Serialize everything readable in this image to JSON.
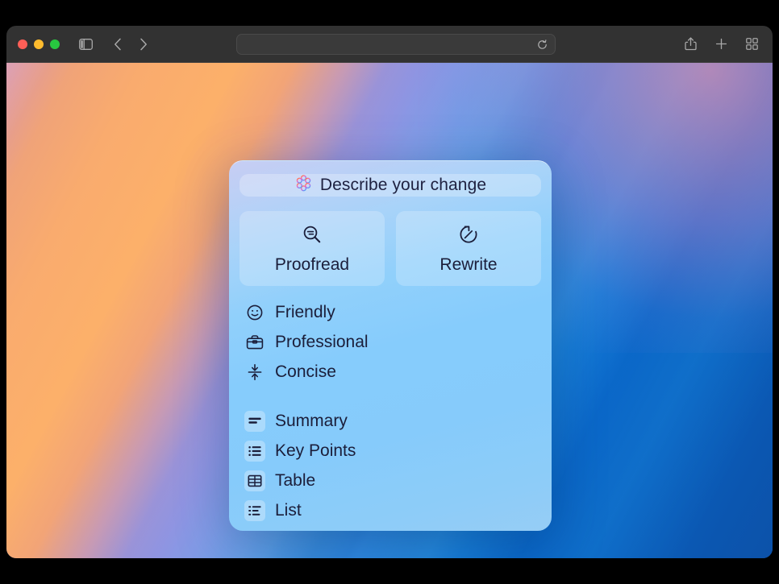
{
  "window": {
    "traffic_lights": [
      "close",
      "minimize",
      "zoom"
    ],
    "toolbar": {
      "sidebar_toggle": "sidebar-toggle-icon",
      "back": "chevron-left-icon",
      "forward": "chevron-right-icon",
      "address_value": "",
      "address_placeholder": "",
      "reload": "reload-icon",
      "share": "share-icon",
      "new_tab": "plus-icon",
      "tab_overview": "tab-grid-icon"
    }
  },
  "popover": {
    "describe": {
      "icon": "apple-intelligence-icon",
      "label": "Describe your change"
    },
    "actions": [
      {
        "label": "Proofread",
        "icon": "text-magnifyingglass-icon"
      },
      {
        "label": "Rewrite",
        "icon": "rewrite-circle-arrow-icon"
      }
    ],
    "tone_items": [
      {
        "label": "Friendly",
        "icon": "smiley-face-icon"
      },
      {
        "label": "Professional",
        "icon": "briefcase-icon"
      },
      {
        "label": "Concise",
        "icon": "compress-arrows-icon"
      }
    ],
    "format_items": [
      {
        "label": "Summary",
        "icon": "summary-lines-icon"
      },
      {
        "label": "Key Points",
        "icon": "bulleted-list-icon"
      },
      {
        "label": "Table",
        "icon": "table-grid-icon"
      },
      {
        "label": "List",
        "icon": "dashed-list-icon"
      }
    ]
  },
  "colors": {
    "popover_top": "#c7cdf3",
    "popover_bottom": "#8ccdf8",
    "text": "#1b1e3a",
    "toolbar_bg": "#323232",
    "traffic_red": "#ff5f57",
    "traffic_yellow": "#febc2e",
    "traffic_green": "#28c840",
    "wallpaper_orange": "#fcb06a",
    "wallpaper_purple": "#b58ac8",
    "wallpaper_blue": "#0d4fa4"
  }
}
